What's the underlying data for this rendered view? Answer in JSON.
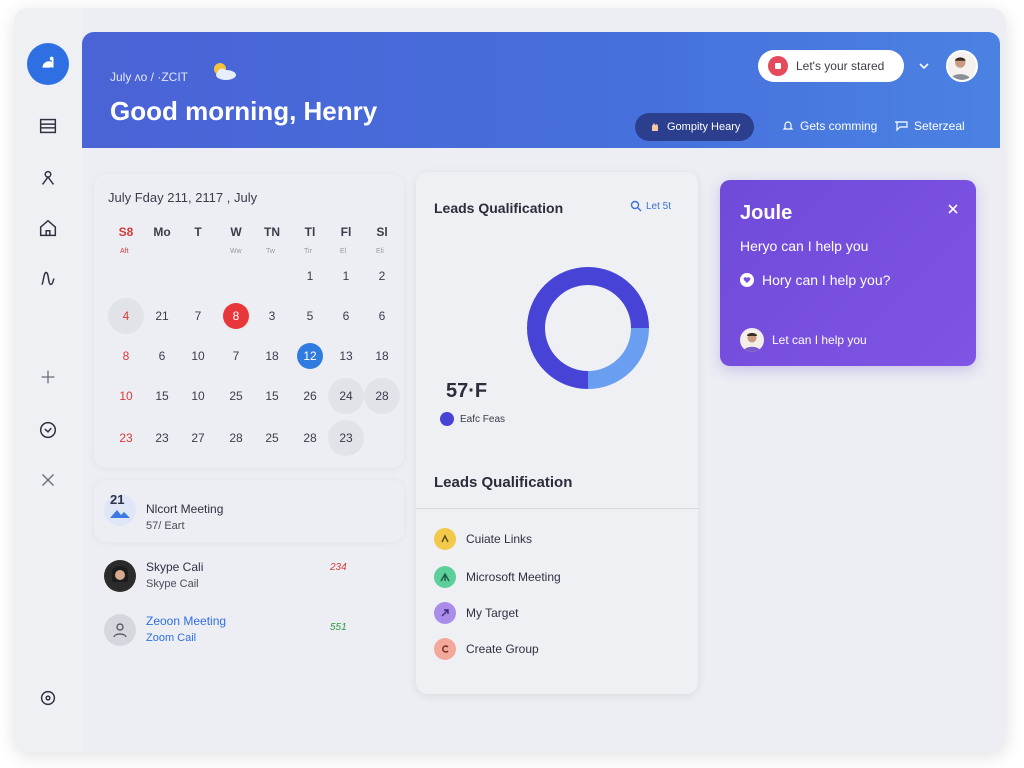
{
  "window": {
    "traffic_colors": [
      "#f0a44a",
      "#5bc46a"
    ]
  },
  "sidebar": {
    "items": [
      {
        "name": "logo",
        "icon": "app-logo-icon"
      },
      {
        "name": "list",
        "icon": "list-icon"
      },
      {
        "name": "people",
        "icon": "person-icon"
      },
      {
        "name": "home",
        "icon": "home-icon"
      },
      {
        "name": "activity",
        "icon": "activity-icon"
      },
      {
        "name": "add",
        "icon": "plus-icon"
      },
      {
        "name": "chat",
        "icon": "chat-icon"
      },
      {
        "name": "close",
        "icon": "x-icon"
      },
      {
        "name": "settings",
        "icon": "settings-icon"
      }
    ]
  },
  "header": {
    "date_line": "July ʌo / ·ZCIT",
    "greeting": "Good morning, Henry",
    "start_pill": "Let's your stared",
    "dark_pill": "Gompity Heary",
    "link1": "Gets comming",
    "link2": "Seterzeal",
    "accent": "#4a63d6"
  },
  "calendar": {
    "title": "July Fday  211,  2117 ,  July",
    "weekdays": [
      "S8",
      "Mo",
      "T",
      "W",
      "TN",
      "Tl",
      "Fl",
      "Sl"
    ],
    "subrow": [
      "Aft",
      "",
      "",
      "Ww",
      "Tw",
      "Tir",
      "El",
      "Eli"
    ],
    "rows": [
      [
        "",
        "",
        "",
        "",
        "",
        "1",
        "1",
        "2"
      ],
      [
        "4",
        "21",
        "7",
        "8",
        "3",
        "5",
        "6",
        "6"
      ],
      [
        "8",
        "6",
        "10",
        "7",
        "18",
        "12",
        "13",
        "18"
      ],
      [
        "10",
        "15",
        "10",
        "25",
        "15",
        "26",
        "24",
        "28"
      ],
      [
        "23",
        "23",
        "27",
        "28",
        "25",
        "28",
        "23",
        ""
      ]
    ]
  },
  "events": {
    "main": {
      "day": "21",
      "title": "Nlcort Meeting",
      "sub": "57/ Eart"
    },
    "items": [
      {
        "title": "Skype Cali",
        "sub": "Skype Cail",
        "time": "234",
        "time_color": "#d83a3a"
      },
      {
        "title": "Zeoon Meeting",
        "sub": "Zoom Cail",
        "time": "551",
        "time_color": "#2a9a44"
      }
    ]
  },
  "leads": {
    "title": "Leads Qualification",
    "search": "Let 5t",
    "stat": "57·F",
    "legend": "Eafc Feas",
    "title2": "Leads Qualification",
    "actions": [
      {
        "label": "Cuiate Links",
        "icon": "link-icon",
        "color": "#f2c94a"
      },
      {
        "label": "Microsoft Meeting",
        "icon": "meeting-icon",
        "color": "#5ccf9a"
      },
      {
        "label": "My Target",
        "icon": "target-icon",
        "color": "#a98de8"
      },
      {
        "label": "Create Group",
        "icon": "group-icon",
        "color": "#f2a89a"
      }
    ]
  },
  "chart_data": {
    "type": "pie",
    "values": [
      75,
      25
    ],
    "colors": [
      "#4643d6",
      "#6a9ef0"
    ]
  },
  "joule": {
    "title": "Joule",
    "line1": "Heryo can I help you",
    "line2": "Hory can I help you?",
    "line3": "Let can I help you"
  }
}
